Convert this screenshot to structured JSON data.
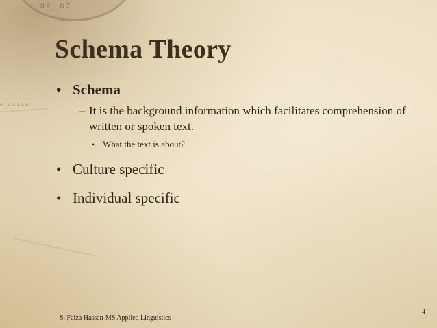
{
  "slide": {
    "title": "Schema Theory",
    "bullets": [
      {
        "marker": "•",
        "text": "Schema",
        "sub": {
          "marker": "–",
          "text": "It is the background information which facilitates comprehension of written or spoken text.",
          "sub": {
            "marker": "•",
            "text": "What the text is about?"
          }
        }
      },
      {
        "marker": "•",
        "text": "Culture specific"
      },
      {
        "marker": "•",
        "text": "Individual specific"
      }
    ],
    "footer": "S. Faiza Hassan-MS Applied Linguistics",
    "page_number": "4"
  },
  "background": {
    "compass_text": "09I   07",
    "map_label": "E SCALE"
  }
}
